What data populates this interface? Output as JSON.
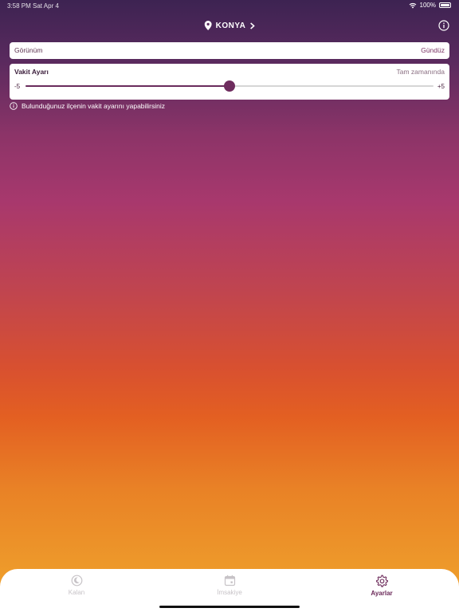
{
  "status_bar": {
    "time": "3:58 PM  Sat Apr 4",
    "battery": "100%"
  },
  "nav": {
    "location": "KONYA"
  },
  "view": {
    "label": "Görünüm",
    "value": "Gündüz"
  },
  "time_adjust": {
    "title": "Vakit Ayarı",
    "status": "Tam zamanında",
    "min_label": "-5",
    "max_label": "+5",
    "min": -5,
    "max": 5,
    "value": 0
  },
  "hint": {
    "text": "Bulunduğunuz ilçenin vakit ayarını yapabilirsiniz"
  },
  "tabs": [
    {
      "label": "Kalan",
      "icon": "moon-icon",
      "active": false
    },
    {
      "label": "İmsakiye",
      "icon": "calendar-icon",
      "active": false
    },
    {
      "label": "Ayarlar",
      "icon": "gear-icon",
      "active": true
    }
  ],
  "colors": {
    "accent": "#6c2a5a",
    "inactive_tab": "#c7c3c7"
  }
}
